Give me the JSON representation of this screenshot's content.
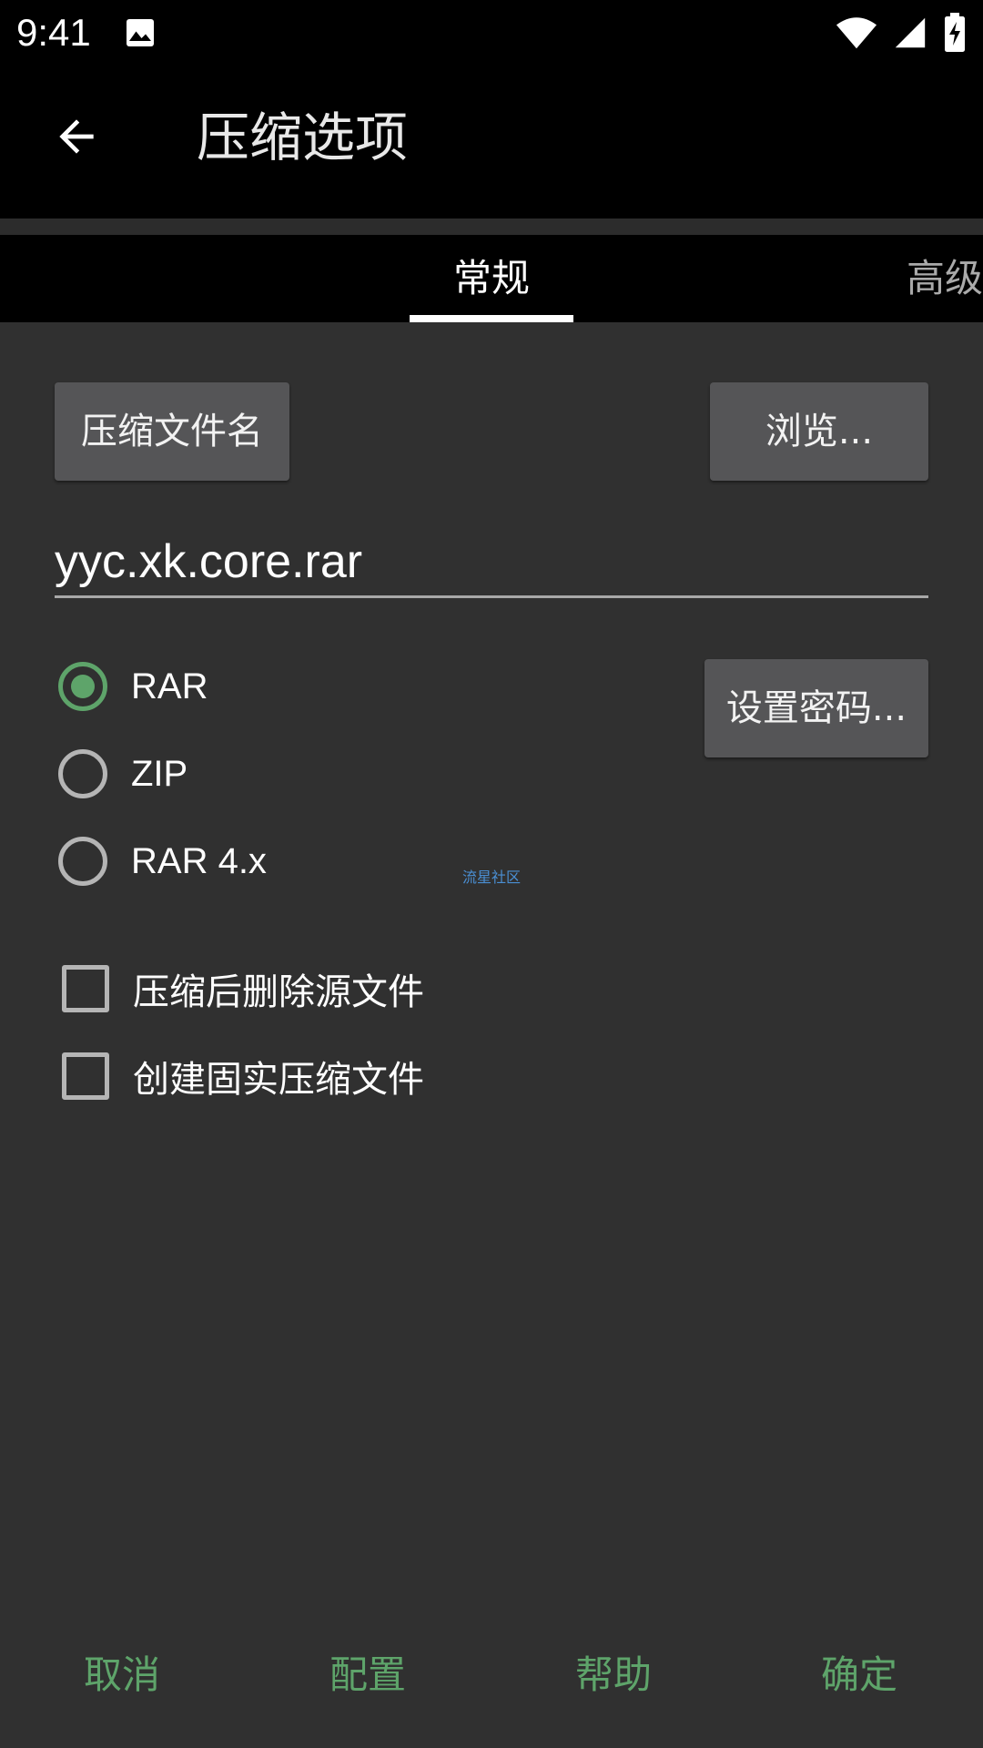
{
  "status_bar": {
    "time": "9:41",
    "icons": [
      "image-icon",
      "wifi-icon",
      "signal-icon",
      "battery-charging-icon"
    ]
  },
  "app_bar": {
    "title": "压缩选项",
    "back_icon": "arrow-left-icon"
  },
  "tabs": [
    {
      "label": "常规",
      "selected": true
    },
    {
      "label": "高级",
      "selected": false
    }
  ],
  "general": {
    "archive_name_button": "压缩文件名",
    "browse_button": "浏览...",
    "filename_value": "yyc.xk.core.rar",
    "set_password_button": "设置密码...",
    "formats": [
      {
        "label": "RAR",
        "checked": true
      },
      {
        "label": "ZIP",
        "checked": false
      },
      {
        "label": "RAR 4.x",
        "checked": false
      }
    ],
    "options": [
      {
        "label": "压缩后删除源文件",
        "checked": false
      },
      {
        "label": "创建固实压缩文件",
        "checked": false
      }
    ],
    "watermark": "流星社区"
  },
  "actions": {
    "cancel": "取消",
    "config": "配置",
    "help": "帮助",
    "ok": "确定"
  },
  "colors": {
    "accent": "#5ea46a",
    "background": "#303030",
    "bar": "#000000",
    "button": "#555557"
  }
}
